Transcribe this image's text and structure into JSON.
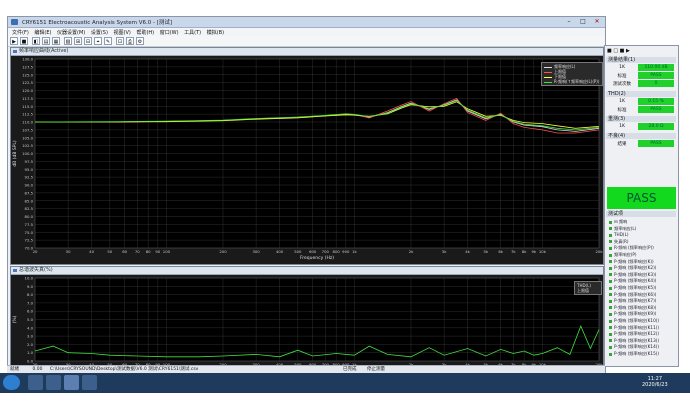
{
  "window": {
    "title": "CRY6151 Electroacoustic Analysis System V6.0 - [测试]",
    "min": "–",
    "max": "□",
    "close": "✕"
  },
  "menu": [
    "文件(F)",
    "编辑(E)",
    "仪器设置(M)",
    "设置(S)",
    "视图(V)",
    "帮助(H)",
    "窗口(W)",
    "工具(T)",
    "模拟(B)"
  ],
  "toolbar": {
    "buttons": [
      "▶",
      "■",
      "◧",
      "▤",
      "▦",
      "▧",
      "⊞",
      "⊟",
      "⌖",
      "✎",
      "⊡",
      "⎙",
      "⚙"
    ]
  },
  "freq_panel": {
    "title": "频率响应曲线(Active)",
    "ylabel": "dB (dB SPL)",
    "xlabel": "Frequency (Hz)"
  },
  "thd_panel": {
    "title": "总谐波失真(%)",
    "ylabel": "(%)",
    "xlabel": "Frequency (Hz)"
  },
  "legend_top": {
    "items": [
      {
        "label": "频率响应(L)",
        "color": "#dddddd"
      },
      {
        "label": "上限值",
        "color": "#ff5050"
      },
      {
        "label": "下限值",
        "color": "#ffff40"
      },
      {
        "label": "R-频响(↑频率响应(L)(P))",
        "color": "#40e040"
      }
    ]
  },
  "legend_bottom": {
    "items": [
      {
        "label": "THD(L)"
      },
      {
        "label": "上限值"
      }
    ]
  },
  "chart_data": [
    {
      "type": "line",
      "title": "",
      "xlabel": "Frequency (Hz)",
      "ylabel": "dB (dB SPL)",
      "xscale": "log",
      "xlim": [
        20,
        20000
      ],
      "ylim": [
        70,
        130
      ],
      "xticks": [
        20,
        30,
        40,
        50,
        60,
        70,
        80,
        90,
        100,
        200,
        300,
        400,
        500,
        600,
        700,
        800,
        900,
        1000,
        2000,
        3000,
        4000,
        5000,
        6000,
        7000,
        8000,
        9000,
        10000,
        20000
      ],
      "xtick_labels": [
        "20",
        "30",
        "40",
        "50",
        "60",
        "70",
        "80",
        "90",
        "100",
        "200",
        "300",
        "400",
        "500",
        "600",
        "700",
        "800",
        "900",
        "1k",
        "2k",
        "3k",
        "4k",
        "5k",
        "6k",
        "7k",
        "8k",
        "9k",
        "10k",
        "20k"
      ],
      "yticks": [
        70,
        72.5,
        75,
        77.5,
        80,
        82.5,
        85,
        87.5,
        90,
        92.5,
        95,
        97.5,
        100,
        102.5,
        105,
        107.5,
        110,
        112.5,
        115,
        117.5,
        120,
        122.5,
        125,
        127.5,
        130
      ],
      "ytick_labels": [
        "70.0",
        "72.5",
        "75.0",
        "77.5",
        "80.0",
        "82.5",
        "85.0",
        "87.5",
        "90.0",
        "92.5",
        "95.0",
        "97.5",
        "100.0",
        "102.5",
        "105.0",
        "107.5",
        "110.0",
        "112.5",
        "115.0",
        "117.5",
        "120.0",
        "122.5",
        "125.0",
        "127.5",
        "130.0"
      ],
      "grid": true,
      "legend": "top-right",
      "series": [
        {
          "name": "频率响应(L)",
          "color": "#dddddd",
          "x": [
            20,
            50,
            100,
            200,
            300,
            500,
            700,
            900,
            1000,
            1200,
            1500,
            1800,
            2000,
            2500,
            3000,
            3500,
            4000,
            5000,
            6000,
            7000,
            8000,
            10000,
            12000,
            15000,
            20000
          ],
          "y": [
            110,
            110,
            110.2,
            110.5,
            111,
            111.5,
            112,
            112.5,
            112.3,
            111.5,
            113,
            115,
            116,
            114,
            115.5,
            117,
            113.5,
            111,
            112.5,
            110,
            109,
            108.5,
            107.5,
            107,
            108
          ]
        },
        {
          "name": "上限值",
          "color": "#ff5050",
          "x": [
            20,
            50,
            100,
            200,
            300,
            500,
            700,
            900,
            1000,
            1200,
            1500,
            1800,
            2000,
            2500,
            3000,
            3500,
            4000,
            5000,
            6000,
            7000,
            8000,
            10000,
            12000,
            15000,
            20000
          ],
          "y": [
            110,
            110,
            110.2,
            110.5,
            111,
            111.5,
            112,
            112.5,
            112.4,
            111.3,
            113.5,
            115.5,
            116.5,
            113.5,
            115.8,
            117.5,
            113,
            110.5,
            112.8,
            109.5,
            108.3,
            107.5,
            106.5,
            106.5,
            107.5
          ]
        },
        {
          "name": "下限值",
          "color": "#ffff40",
          "x": [
            20,
            50,
            100,
            200,
            300,
            500,
            700,
            900,
            1000,
            1200,
            1500,
            1800,
            2000,
            2500,
            3000,
            3500,
            4000,
            5000,
            6000,
            7000,
            8000,
            10000,
            12000,
            15000,
            20000
          ],
          "y": [
            110,
            110,
            110.1,
            110.4,
            110.9,
            111.3,
            111.9,
            112.3,
            112.2,
            111.8,
            112.6,
            114.5,
            115.5,
            114.8,
            115,
            116.4,
            114.2,
            111.8,
            112.1,
            110.5,
            109.8,
            109.5,
            108.8,
            108,
            108.6
          ]
        },
        {
          "name": "R-频响(↑频率响应(L)(P))",
          "color": "#40e040",
          "x": [
            20,
            50,
            100,
            200,
            300,
            500,
            700,
            900,
            1000,
            1200,
            1500,
            1800,
            2000,
            2500,
            3000,
            3500,
            4000,
            5000,
            6000,
            7000,
            8000,
            10000,
            12000,
            15000,
            20000
          ],
          "y": [
            110,
            110.1,
            110.3,
            110.6,
            111.1,
            111.6,
            112.1,
            112.6,
            112.4,
            111.7,
            112.8,
            114.8,
            115.8,
            114.3,
            115.3,
            116.8,
            113.8,
            111.3,
            112.3,
            110.2,
            109.3,
            108.8,
            108,
            107.5,
            108.3
          ]
        }
      ]
    },
    {
      "type": "line",
      "title": "",
      "xlabel": "Frequency (Hz)",
      "ylabel": "(%)",
      "xscale": "log",
      "xlim": [
        20,
        20000
      ],
      "ylim": [
        0,
        10
      ],
      "yticks": [
        0,
        1,
        2,
        3,
        4,
        5,
        6,
        7,
        8,
        9,
        10
      ],
      "ytick_labels": [
        "0.0",
        "1.0",
        "2.0",
        "3.0",
        "4.0",
        "5.0",
        "6.0",
        "7.0",
        "8.0",
        "9.0",
        "10.0"
      ],
      "xticks": [
        20,
        30,
        40,
        50,
        60,
        70,
        80,
        90,
        100,
        200,
        300,
        400,
        500,
        600,
        700,
        800,
        900,
        1000,
        2000,
        3000,
        4000,
        5000,
        6000,
        7000,
        8000,
        9000,
        10000,
        20000
      ],
      "xtick_labels": [
        "20",
        "30",
        "40",
        "50",
        "60",
        "70",
        "80",
        "90",
        "100",
        "200",
        "300",
        "400",
        "500",
        "600",
        "700",
        "800",
        "900",
        "1k",
        "2k",
        "3k",
        "4k",
        "5k",
        "6k",
        "7k",
        "8k",
        "9k",
        "10k",
        "20k"
      ],
      "grid": true,
      "legend": "top-right",
      "series": [
        {
          "name": "THD(L)",
          "color": "#40e040",
          "x": [
            20,
            25,
            30,
            40,
            50,
            70,
            100,
            150,
            200,
            300,
            400,
            500,
            600,
            800,
            1000,
            1200,
            1500,
            2000,
            2500,
            3000,
            4000,
            5000,
            6000,
            7000,
            8000,
            9000,
            10000,
            12000,
            14000,
            16000,
            18000,
            20000
          ],
          "y": [
            1.2,
            1.8,
            1.0,
            0.9,
            0.7,
            0.6,
            0.5,
            0.5,
            0.6,
            0.8,
            0.5,
            1.3,
            0.6,
            0.9,
            0.7,
            1.8,
            0.8,
            0.5,
            1.6,
            0.7,
            1.5,
            0.6,
            1.4,
            0.9,
            1.2,
            0.7,
            0.9,
            1.6,
            0.8,
            4.2,
            1.5,
            3.8
          ]
        }
      ]
    }
  ],
  "right_panel": {
    "header_icons": [
      "■",
      "□",
      "■",
      "▶"
    ],
    "sec1": "测量结果(1)",
    "sec1_rows": [
      {
        "k": "1K",
        "v": "110.00 dB"
      },
      {
        "k": "标准",
        "v": "PASS"
      },
      {
        "k": "测试次数",
        "v": "0"
      }
    ],
    "sec2": "THD(2)",
    "sec2_rows": [
      {
        "k": "1K",
        "v": "0.15 %"
      },
      {
        "k": "标准",
        "v": "PASS"
      }
    ],
    "sec3": "重测(3)",
    "sec3_rows": [
      {
        "k": "1K",
        "v": "28.0 Ω"
      }
    ],
    "sec4": "不良(4)",
    "sec4_rows": [
      {
        "k": "结果",
        "v": "PASS"
      }
    ],
    "pass": "PASS",
    "tree_title": "测试项",
    "tree": [
      "⊟ 频响",
      "频率响应(L)",
      "THD(L)",
      "失真(R)",
      "R-频响 (频率响应(P))",
      "频率响应(P)",
      "P-频响 (频率响应(K))",
      "P-频响 (频率响应(K2))",
      "P-频响 (频率响应(K3))",
      "P-频响 (频率响应(K4))",
      "P-频响 (频率响应(K5))",
      "P-频响 (频率响应(K6))",
      "P-频响 (频率响应(K7))",
      "P-频响 (频率响应(K8))",
      "P-频响 (频率响应(K9))",
      "P-频响 (频率响应(K10))",
      "P-频响 (频率响应(K11))",
      "P-频响 (频率响应(K12))",
      "P-频响 (频率响应(K13))",
      "P-频响 (频率响应(K14))",
      "P-频响 (频率响应(K15))"
    ]
  },
  "statusbar": {
    "left": "就绪",
    "path": "C:\\Users\\CRYSOUND\\Desktop\\测试数据\\V6.0 测试\\CRY6151\\测试.csv",
    "mid": "0.00",
    "right1": "已完成",
    "right2": "停止测量"
  },
  "taskbar": {
    "time": "11:27",
    "date": "2020/6/23"
  }
}
